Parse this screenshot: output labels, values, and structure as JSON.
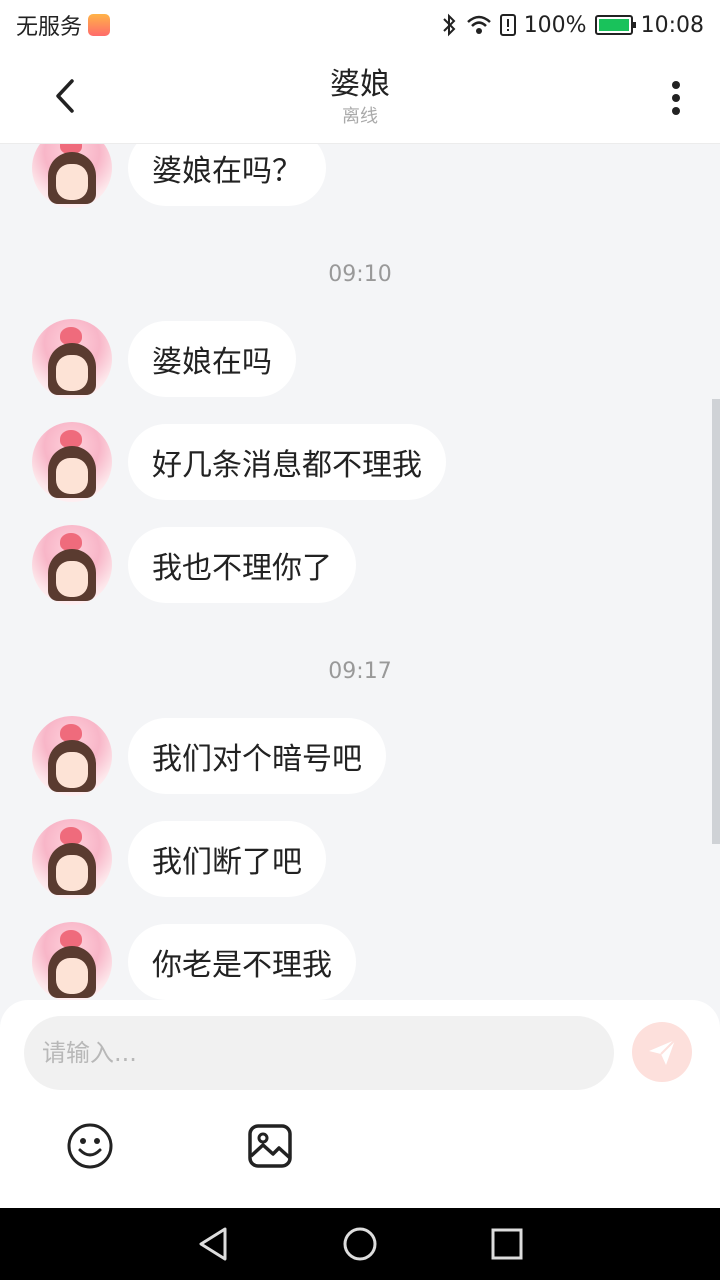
{
  "status_bar": {
    "carrier": "无服务",
    "battery": "100%",
    "time": "10:08"
  },
  "header": {
    "title": "婆娘",
    "subtitle": "离线"
  },
  "messages": [
    {
      "type": "msg",
      "text": "婆娘在吗？"
    },
    {
      "type": "time",
      "text": "09:10"
    },
    {
      "type": "msg",
      "text": "婆娘在吗"
    },
    {
      "type": "msg",
      "text": "好几条消息都不理我"
    },
    {
      "type": "msg",
      "text": "我也不理你了"
    },
    {
      "type": "time",
      "text": "09:17"
    },
    {
      "type": "msg",
      "text": "我们对个暗号吧"
    },
    {
      "type": "msg",
      "text": "我们断了吧"
    },
    {
      "type": "msg",
      "text": "你老是不理我"
    }
  ],
  "input": {
    "placeholder": "请输入..."
  },
  "icons": {
    "back": "chevron-left-icon",
    "more": "more-vertical-icon",
    "send": "send-icon",
    "emoji": "emoji-icon",
    "image": "image-icon"
  },
  "colors": {
    "send_button_bg": "#fde0dc",
    "battery_fill": "#19c25b"
  }
}
